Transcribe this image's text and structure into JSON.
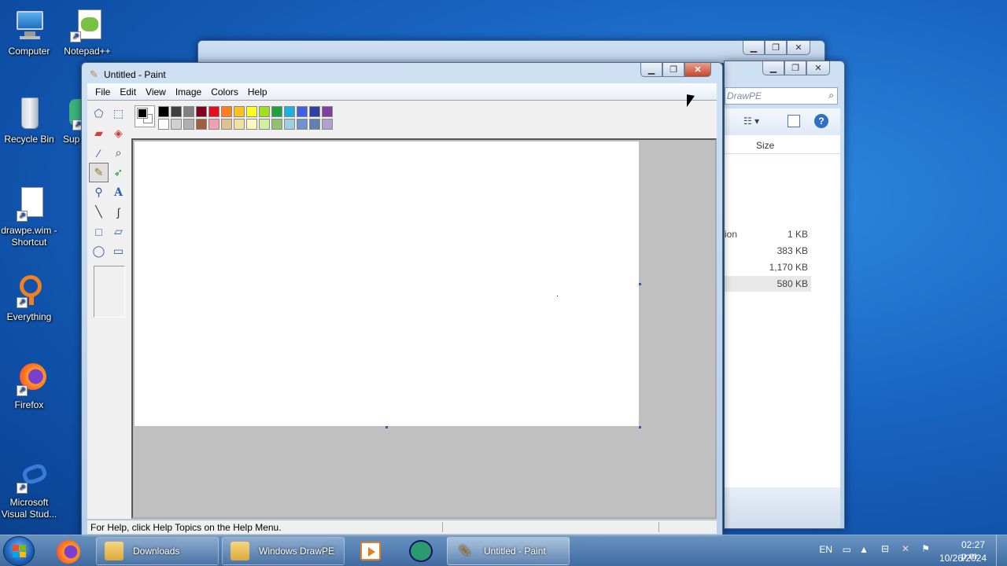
{
  "desktop": {
    "icons": [
      {
        "label": "Computer"
      },
      {
        "label": "Notepad++"
      },
      {
        "label": "Recycle Bin"
      },
      {
        "label": "Sup"
      },
      {
        "label": "drawpe.wim - Shortcut"
      },
      {
        "label": "Everything"
      },
      {
        "label": "Firefox"
      },
      {
        "label": "Microsoft Visual Stud..."
      }
    ]
  },
  "paint": {
    "title": "Untitled - Paint",
    "menu": [
      "File",
      "Edit",
      "View",
      "Image",
      "Colors",
      "Help"
    ],
    "tools": [
      "free-select-icon",
      "rect-select-icon",
      "eraser-icon",
      "fill-icon",
      "color-picker-icon",
      "magnifier-icon",
      "pencil-icon",
      "brush-icon",
      "airbrush-icon",
      "text-icon",
      "line-icon",
      "curve-icon",
      "rectangle-icon",
      "polygon-icon",
      "ellipse-icon",
      "rounded-rect-icon"
    ],
    "selected_tool": "pencil-icon",
    "palette_top": [
      "#000000",
      "#404040",
      "#808080",
      "#800020",
      "#e01020",
      "#ff7f20",
      "#ffc020",
      "#ffff20",
      "#a0e020",
      "#20a040",
      "#20b0e0",
      "#4060e0",
      "#3040a0",
      "#8040a0"
    ],
    "palette_bottom": [
      "#ffffff",
      "#d0d0d0",
      "#b0b0b0",
      "#a06040",
      "#f0a0b0",
      "#e0c090",
      "#f0e0a0",
      "#f8f8c0",
      "#d0f0a0",
      "#90c070",
      "#a0d0e0",
      "#7090d0",
      "#6080b0",
      "#b0a0d0"
    ],
    "status_text": "For Help, click Help Topics on the Help Menu."
  },
  "explorer": {
    "search_placeholder": "DrawPE",
    "column_size": "Size",
    "rows": [
      {
        "name_fragment": "ion",
        "size": "1 KB"
      },
      {
        "name_fragment": "",
        "size": "383 KB"
      },
      {
        "name_fragment": "",
        "size": "1,170 KB"
      },
      {
        "name_fragment": "",
        "size": "580 KB"
      }
    ]
  },
  "taskbar": {
    "buttons": [
      {
        "label": "Downloads"
      },
      {
        "label": "Windows DrawPE"
      },
      {
        "label": "Untitled - Paint"
      }
    ],
    "lang": "EN",
    "time": "02:27 p.m.",
    "date": "10/26/2024"
  }
}
